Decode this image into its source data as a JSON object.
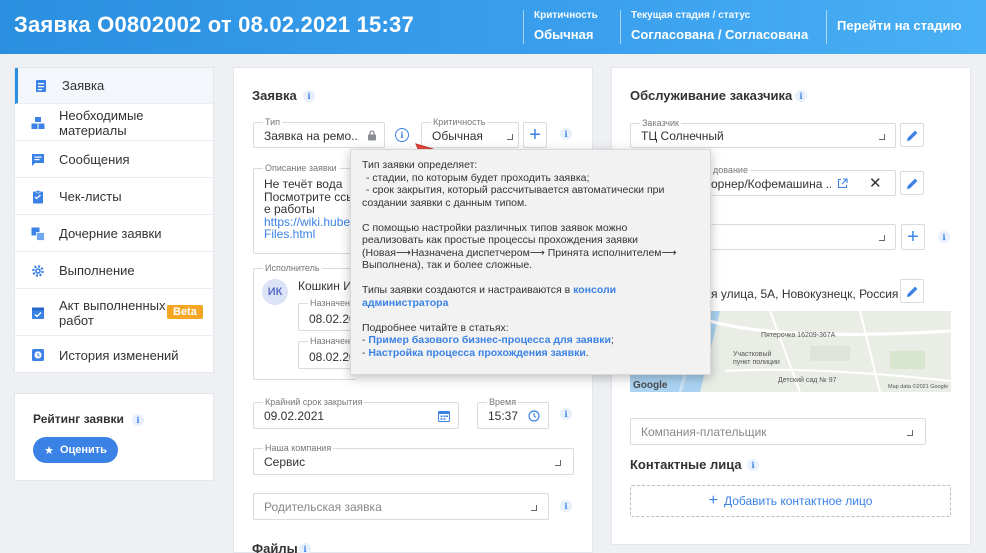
{
  "header": {
    "title": "Заявка О0802002 от 08.02.2021 15:37",
    "criticality_label": "Критичность",
    "criticality_value": "Обычная",
    "stage_label": "Текущая стадия / статус",
    "stage_value": "Согласована / Согласована",
    "go_stage": "Перейти на стадию"
  },
  "sidebar": {
    "items": [
      {
        "label": "Заявка",
        "icon": "document-icon"
      },
      {
        "label": "Необходимые материалы",
        "icon": "boxes-icon"
      },
      {
        "label": "Сообщения",
        "icon": "message-icon"
      },
      {
        "label": "Чек-листы",
        "icon": "checklist-icon"
      },
      {
        "label": "Дочерние заявки",
        "icon": "child-requests-icon"
      },
      {
        "label": "Выполнение",
        "icon": "gear-icon"
      },
      {
        "label": "Акт выполненных",
        "label2": "работ",
        "icon": "act-icon",
        "badge": "Beta"
      },
      {
        "label": "История изменений",
        "icon": "clock-icon"
      }
    ]
  },
  "rating": {
    "title": "Рейтинг заявки",
    "button": "Оценить"
  },
  "request": {
    "title": "Заявка",
    "type_label": "Тип",
    "type_value": "Заявка на ремо...",
    "crit_label": "Критичность",
    "crit_value": "Обычная",
    "desc_label": "Описание заявки",
    "desc_line1": "Не течёт вода",
    "desc_line2": "Посмотрите ссы",
    "desc_line3": "е работы",
    "desc_link1": "https://wiki.hube",
    "desc_link2": "Files.html",
    "exec_label": "Исполнитель",
    "exec_initials": "ИК",
    "exec_name": "Кошкин И",
    "assigned_label": "Назначен",
    "assigned1": "08.02.20",
    "assigned2": "08.02.20",
    "deadline_label": "Крайний срок закрытия",
    "deadline_value": "09.02.2021",
    "time_label": "Время",
    "time_value": "15:37",
    "company_label": "Наша компания",
    "company_value": "Сервис",
    "parent_placeholder": "Родительская заявка",
    "files_title": "Файлы"
  },
  "tooltip": {
    "l1": "Тип заявки определяет:",
    "l2": " - стадии, по которым будет проходить заявка;",
    "l3": " - срок закрытия, который рассчитывается автоматически при",
    "l4": "создании заявки с данным типом.",
    "l5": "С помощью настройки различных типов заявок можно",
    "l6": "реализовать как простые процессы прохождения заявки",
    "l7": "(Новая⟶Назначена диспетчером⟶ Принята исполнителем⟶",
    "l8": "Выполнена), так и более сложные.",
    "l9": "Типы заявки создаются и настраиваются в ",
    "l9_link": "консоли",
    "l10_link": "администратора",
    "l11": "Подробнее читайте в статьях:",
    "l12_prefix": " - ",
    "l12_link": "Пример базового бизнес-процесса для заявки",
    "l12_suffix": ";",
    "l13_prefix": " - ",
    "l13_link": "Настройка процесса прохождения заявки",
    "l13_suffix": "."
  },
  "service": {
    "title": "Обслуживание заказчика",
    "customer_label": "Заказчик",
    "customer_value": "ТЦ Солнечный",
    "equipment_label": "дование",
    "equipment_value": "орнер/Кофемашина ...",
    "address_value": "я улица, 5А, Новокузнецк, Россия",
    "map_label1": "Пятерочка 16209-367А",
    "map_label2": "Участковый пункт полиции",
    "map_label3": "Детский сад № 97",
    "map_google": "Google",
    "map_credits": "Map data ©2021 Google",
    "payer_placeholder": "Компания-плательщик",
    "contacts_title": "Контактные лица",
    "add_contact": "Добавить контактное лицо"
  },
  "colors": {
    "accent": "#2a8fe0",
    "link": "#3b82e6",
    "badge": "#f5a623"
  }
}
